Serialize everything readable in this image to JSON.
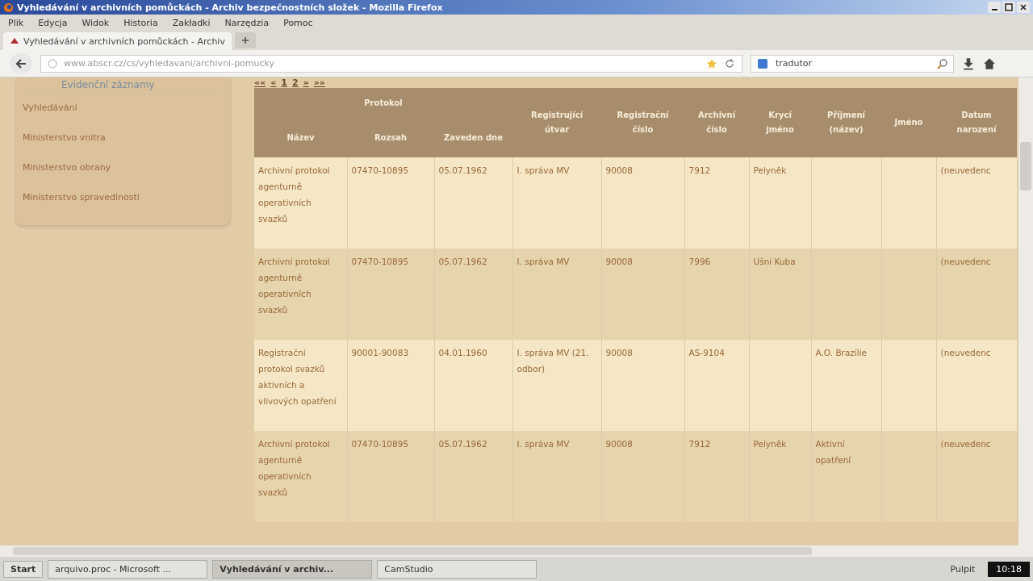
{
  "window": {
    "title": "Vyhledávání v archivních pomůckách - Archiv bezpečnostních složek - Mozilla Firefox"
  },
  "menu": [
    "Plik",
    "Edycja",
    "Widok",
    "Historia",
    "Zakładki",
    "Narzędzia",
    "Pomoc"
  ],
  "tabs": [
    {
      "label": "Vyhledávání v archivních pomůckách - Archiv",
      "selected": true
    }
  ],
  "address": {
    "value": "www.abscr.cz/cs/vyhledavani/archivni-pomucky"
  },
  "search": {
    "value": "tradutor"
  },
  "sidebar": {
    "heading": "Evidenční záznamy",
    "items": [
      "Vyhledávání",
      "Ministerstvo vnitra",
      "Ministerstvo obrany",
      "Ministerstvo spravedlnosti"
    ]
  },
  "pagination": [
    "««",
    "«",
    "1",
    "2",
    "»",
    "»»"
  ],
  "table": {
    "group": {
      "label": "Protokol"
    },
    "columns": [
      "Název",
      "Rozsah",
      "Zaveden dne",
      "Registrující útvar",
      "Registrační číslo",
      "Archivní číslo",
      "Krycí jméno",
      "Příjmení (název)",
      "Jméno",
      "Datum narození"
    ],
    "rows": [
      [
        "Archivní protokol agenturně operativních svazků",
        "07470-10895",
        "05.07.1962",
        "I. správa MV",
        "90008",
        "7912",
        "Pelyněk",
        "",
        "",
        "(neuvedenc"
      ],
      [
        "Archivní protokol agenturně operativních svazků",
        "07470-10895",
        "05.07.1962",
        "I. správa MV",
        "90008",
        "7996",
        "Ušní Kuba",
        "",
        "",
        "(neuvedenc"
      ],
      [
        "Registrační protokol svazků aktivních a vlivových opatření",
        "90001-90083",
        "04.01.1960",
        "I. správa MV (21. odbor)",
        "90008",
        "AS-9104",
        "",
        "A.O. Brazílie",
        "",
        "(neuvedenc"
      ],
      [
        "Archivní protokol agenturně operativních svazků",
        "07470-10895",
        "05.07.1962",
        "I. správa MV",
        "90008",
        "7912",
        "Pelyněk",
        "Aktivní opatření",
        "",
        "(neuvedenc"
      ]
    ]
  },
  "taskbar": {
    "start": "Start",
    "items": [
      {
        "label": "arquivo.proc - Microsoft ...",
        "selected": false
      },
      {
        "label": "Vyhledávání v archiv...",
        "selected": true
      },
      {
        "label": "CamStudio",
        "selected": false
      }
    ],
    "tray": "Pulpit",
    "clock": "10:18"
  }
}
